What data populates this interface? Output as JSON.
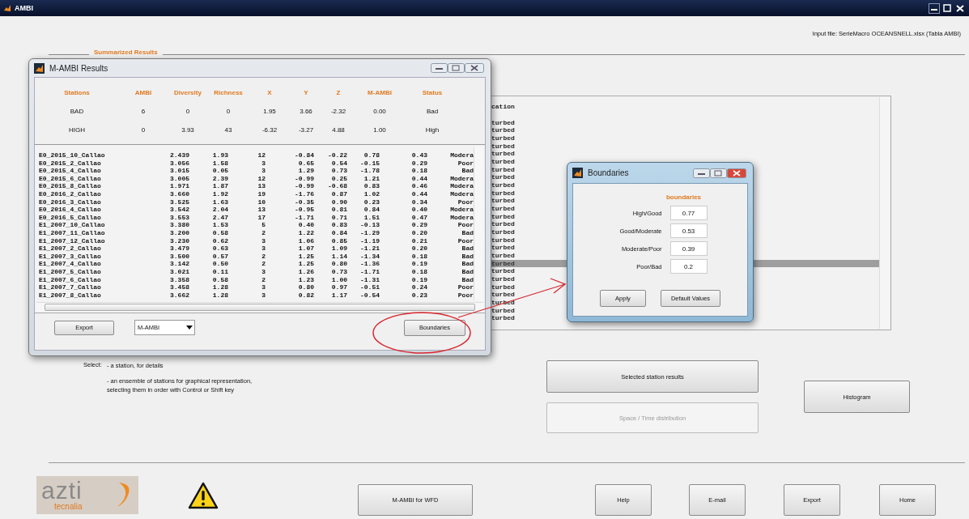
{
  "window": {
    "title": "AMBI"
  },
  "input_file": "Input file: SerieMacro OCEANSNELL.xlsx (Tabla AMBI)",
  "panel": {
    "title": "Summarized Results"
  },
  "background_list": {
    "header": "cation",
    "rows": [
      {
        "text": "turbed",
        "selected": false
      },
      {
        "text": "turbed",
        "selected": false
      },
      {
        "text": "turbed",
        "selected": false
      },
      {
        "text": "turbed",
        "selected": false
      },
      {
        "text": "turbed",
        "selected": false
      },
      {
        "text": "turbed",
        "selected": false
      },
      {
        "text": "turbed",
        "selected": false
      },
      {
        "text": "turbed",
        "selected": false
      },
      {
        "text": "turbed",
        "selected": false
      },
      {
        "text": "turbed",
        "selected": false
      },
      {
        "text": "turbed",
        "selected": false
      },
      {
        "text": "turbed",
        "selected": false
      },
      {
        "text": "turbed",
        "selected": false
      },
      {
        "text": "turbed",
        "selected": false
      },
      {
        "text": "turbed",
        "selected": false
      },
      {
        "text": "turbed",
        "selected": false
      },
      {
        "text": "turbed",
        "selected": false
      },
      {
        "text": "turbed",
        "selected": false
      },
      {
        "text": "turbed",
        "selected": true
      },
      {
        "text": "turbed",
        "selected": false
      },
      {
        "text": "turbed",
        "selected": false
      },
      {
        "text": "turbed",
        "selected": false
      },
      {
        "text": "turbed",
        "selected": false
      },
      {
        "text": "turbed",
        "selected": false
      },
      {
        "text": "turbed",
        "selected": false
      },
      {
        "text": "turbed",
        "selected": false
      }
    ]
  },
  "select_help": {
    "label": "Select:",
    "items": [
      [
        "- a station, for details"
      ],
      [
        "- an ensemble of stations for graphical representation,",
        "selecting them in order with Control or Shift key"
      ]
    ]
  },
  "action_buttons": [
    {
      "label": "Selected station results",
      "disabled": false
    },
    {
      "label": "Space / Time distribution",
      "disabled": true
    },
    {
      "label": "Histogram",
      "disabled": false
    }
  ],
  "footer": {
    "logo": {
      "name": "azti",
      "sub": "tecnalia"
    },
    "buttons": [
      "M-AMBI for WFD",
      "Help",
      "E-mail",
      "Export",
      "Home"
    ]
  },
  "results_window": {
    "title": "M-AMBI Results",
    "columns": [
      "Stations",
      "AMBI",
      "Diversity",
      "Richness",
      "X",
      "Y",
      "Z",
      "M-AMBI",
      "Status"
    ],
    "reference_rows": [
      [
        "BAD",
        "6",
        "0",
        "0",
        "1.95",
        "3.66",
        "-2.32",
        "0.00",
        "Bad"
      ],
      [
        "HIGH",
        "0",
        "3.93",
        "43",
        "-6.32",
        "-3.27",
        "4.88",
        "1.00",
        "High"
      ]
    ],
    "station_list": [
      [
        "E0_2015_10_Callao",
        "2.439",
        "1.93",
        "12",
        "-0.84",
        "-0.22",
        "0.78",
        "0.43",
        "Modera"
      ],
      [
        "E0_2015_2_Callao",
        "3.056",
        "1.58",
        "3",
        "0.65",
        "0.54",
        "-0.15",
        "0.29",
        "Poor"
      ],
      [
        "E0_2015_4_Callao",
        "3.015",
        "0.05",
        "3",
        "1.29",
        "0.73",
        "-1.78",
        "0.18",
        "Bad"
      ],
      [
        "E0_2015_6_Callao",
        "3.005",
        "2.39",
        "12",
        "-0.99",
        "0.25",
        "1.21",
        "0.44",
        "Modera"
      ],
      [
        "E0_2015_8_Callao",
        "1.971",
        "1.87",
        "13",
        "-0.99",
        "-0.68",
        "0.83",
        "0.46",
        "Modera"
      ],
      [
        "E0_2016_2_Callao",
        "3.660",
        "1.92",
        "19",
        "-1.76",
        "0.87",
        "1.02",
        "0.44",
        "Modera"
      ],
      [
        "E0_2016_3_Callao",
        "3.525",
        "1.63",
        "10",
        "-0.35",
        "0.90",
        "0.23",
        "0.34",
        "Poor"
      ],
      [
        "E0_2016_4_Callao",
        "3.542",
        "2.04",
        "13",
        "-0.95",
        "0.81",
        "0.84",
        "0.40",
        "Modera"
      ],
      [
        "E0_2016_5_Callao",
        "3.553",
        "2.47",
        "17",
        "-1.71",
        "0.71",
        "1.51",
        "0.47",
        "Modera"
      ],
      [
        "E1_2007_10_Callao",
        "3.380",
        "1.53",
        "5",
        "0.40",
        "0.83",
        "-0.13",
        "0.29",
        "Poor"
      ],
      [
        "E1_2007_11_Callao",
        "3.200",
        "0.58",
        "2",
        "1.22",
        "0.84",
        "-1.29",
        "0.20",
        "Bad"
      ],
      [
        "E1_2007_12_Callao",
        "3.230",
        "0.62",
        "3",
        "1.06",
        "0.85",
        "-1.19",
        "0.21",
        "Poor"
      ],
      [
        "E1_2007_2_Callao",
        "3.479",
        "0.63",
        "3",
        "1.07",
        "1.09",
        "-1.21",
        "0.20",
        "Bad"
      ],
      [
        "E1_2007_3_Callao",
        "3.500",
        "0.57",
        "2",
        "1.25",
        "1.14",
        "-1.34",
        "0.18",
        "Bad"
      ],
      [
        "E1_2007_4_Callao",
        "3.142",
        "0.50",
        "2",
        "1.25",
        "0.80",
        "-1.36",
        "0.19",
        "Bad"
      ],
      [
        "E1_2007_5_Callao",
        "3.021",
        "0.11",
        "3",
        "1.26",
        "0.73",
        "-1.71",
        "0.18",
        "Bad"
      ],
      [
        "E1_2007_6_Callao",
        "3.358",
        "0.58",
        "2",
        "1.23",
        "1.00",
        "-1.31",
        "0.19",
        "Bad"
      ],
      [
        "E1_2007_7_Callao",
        "3.458",
        "1.28",
        "3",
        "0.80",
        "0.97",
        "-0.51",
        "0.24",
        "Poor"
      ],
      [
        "E1_2007_8_Callao",
        "3.662",
        "1.28",
        "3",
        "0.82",
        "1.17",
        "-0.54",
        "0.23",
        "Poor"
      ]
    ],
    "export_button": "Export",
    "dropdown": {
      "value": "M-AMBI"
    },
    "boundaries_button": "Boundaries"
  },
  "boundaries_window": {
    "title": "Boundaries",
    "heading": "boundaries",
    "fields": [
      {
        "label": "High/Good",
        "value": "0.77"
      },
      {
        "label": "Good/Moderate",
        "value": "0.53"
      },
      {
        "label": "Moderate/Poor",
        "value": "0.39"
      },
      {
        "label": "Poor/Bad",
        "value": "0.2"
      }
    ],
    "buttons": [
      "Apply",
      "Default Values"
    ]
  }
}
